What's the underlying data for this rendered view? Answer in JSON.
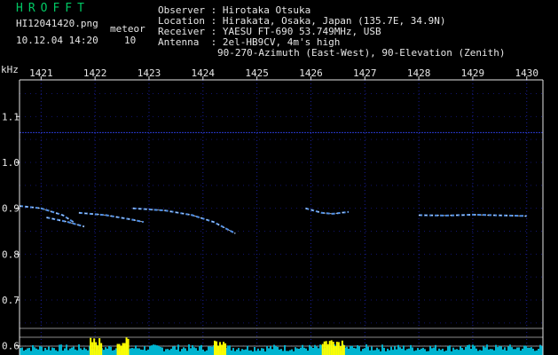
{
  "header": {
    "brand": "HROFFT",
    "filename": "HI12041420.png",
    "datetime": "10.12.04 14:20",
    "meteor_label": "meteor",
    "meteor_count": "10",
    "observer_label": "Observer",
    "observer": "Hirotaka Otsuka",
    "location_label": "Location",
    "location": "Hirakata, Osaka, Japan (135.7E, 34.9N)",
    "receiver_label": "Receiver",
    "receiver": "YAESU FT-690 53.749MHz, USB",
    "antenna_label": "Antenna",
    "antenna": "2el-HB9CV, 4m's high",
    "antenna_detail": "90-270-Azimuth (East-West), 90-Elevation (Zenith)"
  },
  "chart_data": {
    "type": "spectrogram",
    "ylabel": "kHz",
    "x_ticks": [
      "1421",
      "1422",
      "1423",
      "1424",
      "1425",
      "1426",
      "1427",
      "1428",
      "1429",
      "1430"
    ],
    "y_ticks": [
      "1.1",
      "1.0",
      "0.9",
      "0.8",
      "0.7",
      "0.6"
    ],
    "xlim": [
      1420.6,
      1430.3
    ],
    "ylim": [
      0.58,
      1.18
    ],
    "grid": true,
    "colors": {
      "background": "#000000",
      "grid": "#1a1f9c",
      "trace": "#5aa0ff",
      "bright": "#ffffff",
      "level": "#00b4d0",
      "level_peak": "#ffff00"
    },
    "traces": [
      {
        "x": [
          1420.6,
          1421.0,
          1421.4,
          1421.6
        ],
        "y": [
          0.905,
          0.9,
          0.885,
          0.87
        ]
      },
      {
        "x": [
          1421.1,
          1421.5,
          1421.8
        ],
        "y": [
          0.88,
          0.87,
          0.86
        ]
      },
      {
        "x": [
          1421.7,
          1422.2,
          1422.7,
          1422.9
        ],
        "y": [
          0.89,
          0.885,
          0.875,
          0.87
        ]
      },
      {
        "x": [
          1422.7,
          1423.3,
          1423.8,
          1424.2,
          1424.6
        ],
        "y": [
          0.9,
          0.895,
          0.885,
          0.87,
          0.845
        ]
      },
      {
        "x": [
          1425.9,
          1426.2,
          1426.4,
          1426.7
        ],
        "y": [
          0.9,
          0.89,
          0.888,
          0.892
        ]
      },
      {
        "x": [
          1428.0,
          1428.5,
          1429.0,
          1430.0
        ],
        "y": [
          0.885,
          0.884,
          0.886,
          0.883
        ]
      }
    ],
    "level_peaks_x": [
      1422.0,
      1422.5,
      1424.3,
      1426.3,
      1426.5
    ]
  }
}
